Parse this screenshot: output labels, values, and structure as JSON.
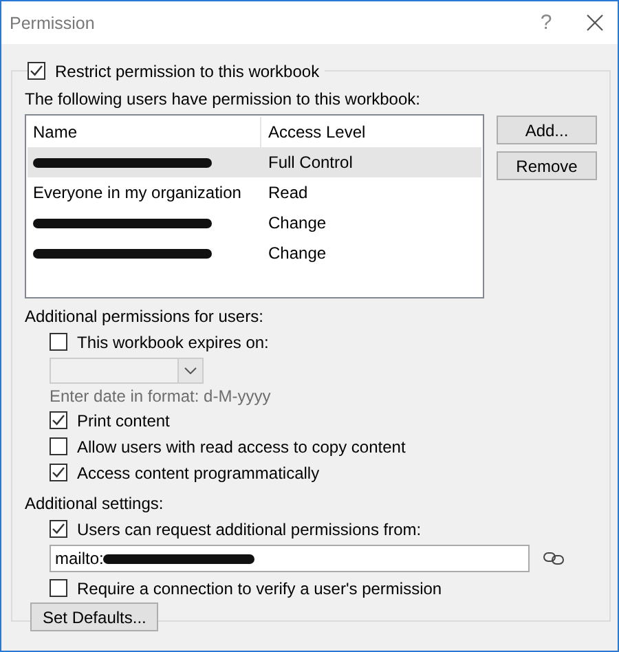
{
  "window": {
    "title": "Permission",
    "help": "?"
  },
  "restrict": {
    "label": "Restrict permission to this workbook",
    "checked": true
  },
  "users_label": "The following users have permission to this workbook:",
  "table": {
    "columns": [
      "Name",
      "Access Level"
    ],
    "rows": [
      {
        "kind": "redacted",
        "access": "Full Control",
        "selected": true
      },
      {
        "kind": "text",
        "name": "Everyone in my organization",
        "access": "Read",
        "selected": false
      },
      {
        "kind": "redacted",
        "access": "Change",
        "selected": false
      },
      {
        "kind": "redacted",
        "access": "Change",
        "selected": false
      }
    ]
  },
  "buttons": {
    "add": "Add...",
    "remove": "Remove"
  },
  "additional_permissions": {
    "heading": "Additional permissions for users:",
    "expires": {
      "label": "This workbook expires on:",
      "checked": false
    },
    "date_dropdown": {
      "disabled": true
    },
    "date_hint": "Enter date in format: d-M-yyyy",
    "options": [
      {
        "label": "Print content",
        "checked": true
      },
      {
        "label": "Allow users with read access to copy content",
        "checked": false
      },
      {
        "label": "Access content programmatically",
        "checked": true
      }
    ]
  },
  "additional_settings": {
    "heading": "Additional settings:",
    "request": {
      "label": "Users can request additional permissions from:",
      "checked": true
    },
    "email_field": {
      "value": "mailto:"
    },
    "require": {
      "label": "Require a connection to verify a user's permission",
      "checked": false
    },
    "set_defaults": "Set Defaults..."
  }
}
